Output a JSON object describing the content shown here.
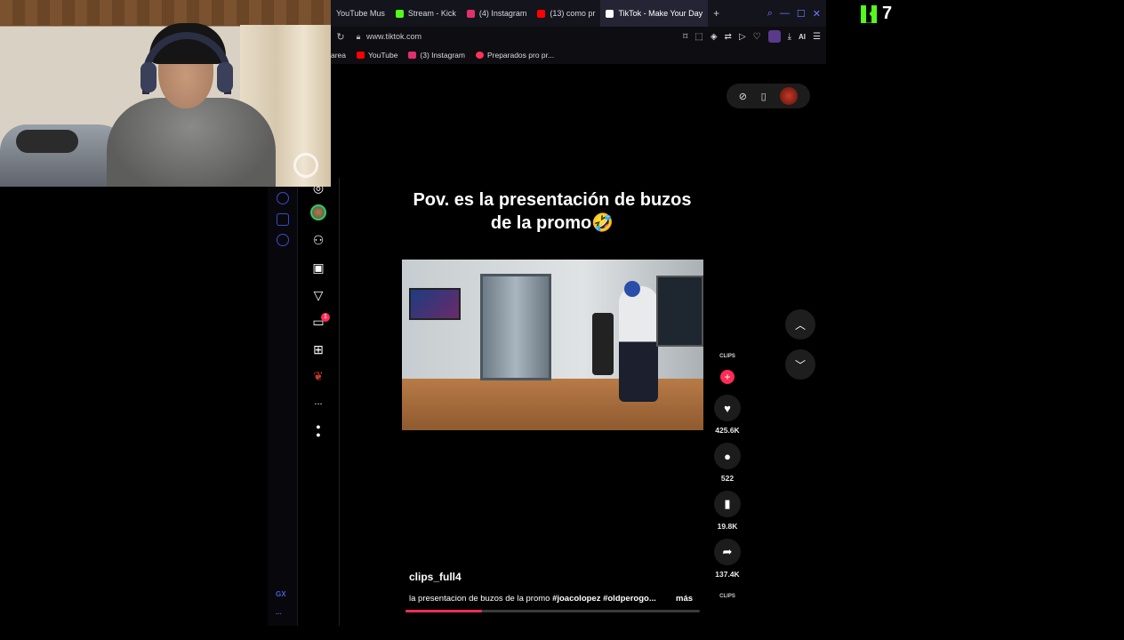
{
  "stream": {
    "kick_count": "7"
  },
  "browser": {
    "tabs": [
      {
        "label": "YouTube Mus",
        "color": "#ffffff"
      },
      {
        "label": "Stream - Kick",
        "color": "#53fc18"
      },
      {
        "label": "(4) Instagram",
        "color": "#e1306c"
      },
      {
        "label": "(13) como pr",
        "color": "#ff0000"
      },
      {
        "label": "TikTok - Make Your Day",
        "color": "#ffffff"
      }
    ],
    "url": "www.tiktok.com",
    "ai_label": "AI",
    "bookmarks": [
      {
        "label": "area",
        "color": ""
      },
      {
        "label": "YouTube",
        "color": "#ff0000"
      },
      {
        "label": "(3) Instagram",
        "color": "#e1306c"
      },
      {
        "label": "Preparados pro pr...",
        "color": "#ff3355"
      }
    ],
    "gx_label": "GX",
    "gx_more": "..."
  },
  "tiktok": {
    "messages_badge": "1",
    "more_label": "...",
    "caption_line1": "Pov. es la presentación de buzos",
    "caption_line2": "de la promo🤣",
    "author": "clips_full4",
    "description": "la presentacion de buzos de la promo ",
    "hashtags": "#joacolopez #oldperogo...",
    "more_link": "más",
    "avatar_label": "CLIPS",
    "counts": {
      "likes": "425.6K",
      "comments": "522",
      "saves": "19.8K",
      "shares": "137.4K"
    },
    "progress": 0.26,
    "accent": "#fe2c55"
  }
}
